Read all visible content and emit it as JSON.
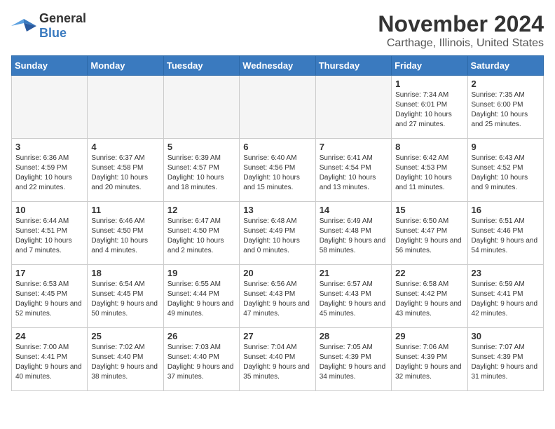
{
  "logo": {
    "general": "General",
    "blue": "Blue"
  },
  "title": "November 2024",
  "location": "Carthage, Illinois, United States",
  "days_of_week": [
    "Sunday",
    "Monday",
    "Tuesday",
    "Wednesday",
    "Thursday",
    "Friday",
    "Saturday"
  ],
  "weeks": [
    [
      {
        "day": "",
        "info": ""
      },
      {
        "day": "",
        "info": ""
      },
      {
        "day": "",
        "info": ""
      },
      {
        "day": "",
        "info": ""
      },
      {
        "day": "",
        "info": ""
      },
      {
        "day": "1",
        "info": "Sunrise: 7:34 AM\nSunset: 6:01 PM\nDaylight: 10 hours and 27 minutes."
      },
      {
        "day": "2",
        "info": "Sunrise: 7:35 AM\nSunset: 6:00 PM\nDaylight: 10 hours and 25 minutes."
      }
    ],
    [
      {
        "day": "3",
        "info": "Sunrise: 6:36 AM\nSunset: 4:59 PM\nDaylight: 10 hours and 22 minutes."
      },
      {
        "day": "4",
        "info": "Sunrise: 6:37 AM\nSunset: 4:58 PM\nDaylight: 10 hours and 20 minutes."
      },
      {
        "day": "5",
        "info": "Sunrise: 6:39 AM\nSunset: 4:57 PM\nDaylight: 10 hours and 18 minutes."
      },
      {
        "day": "6",
        "info": "Sunrise: 6:40 AM\nSunset: 4:56 PM\nDaylight: 10 hours and 15 minutes."
      },
      {
        "day": "7",
        "info": "Sunrise: 6:41 AM\nSunset: 4:54 PM\nDaylight: 10 hours and 13 minutes."
      },
      {
        "day": "8",
        "info": "Sunrise: 6:42 AM\nSunset: 4:53 PM\nDaylight: 10 hours and 11 minutes."
      },
      {
        "day": "9",
        "info": "Sunrise: 6:43 AM\nSunset: 4:52 PM\nDaylight: 10 hours and 9 minutes."
      }
    ],
    [
      {
        "day": "10",
        "info": "Sunrise: 6:44 AM\nSunset: 4:51 PM\nDaylight: 10 hours and 7 minutes."
      },
      {
        "day": "11",
        "info": "Sunrise: 6:46 AM\nSunset: 4:50 PM\nDaylight: 10 hours and 4 minutes."
      },
      {
        "day": "12",
        "info": "Sunrise: 6:47 AM\nSunset: 4:50 PM\nDaylight: 10 hours and 2 minutes."
      },
      {
        "day": "13",
        "info": "Sunrise: 6:48 AM\nSunset: 4:49 PM\nDaylight: 10 hours and 0 minutes."
      },
      {
        "day": "14",
        "info": "Sunrise: 6:49 AM\nSunset: 4:48 PM\nDaylight: 9 hours and 58 minutes."
      },
      {
        "day": "15",
        "info": "Sunrise: 6:50 AM\nSunset: 4:47 PM\nDaylight: 9 hours and 56 minutes."
      },
      {
        "day": "16",
        "info": "Sunrise: 6:51 AM\nSunset: 4:46 PM\nDaylight: 9 hours and 54 minutes."
      }
    ],
    [
      {
        "day": "17",
        "info": "Sunrise: 6:53 AM\nSunset: 4:45 PM\nDaylight: 9 hours and 52 minutes."
      },
      {
        "day": "18",
        "info": "Sunrise: 6:54 AM\nSunset: 4:45 PM\nDaylight: 9 hours and 50 minutes."
      },
      {
        "day": "19",
        "info": "Sunrise: 6:55 AM\nSunset: 4:44 PM\nDaylight: 9 hours and 49 minutes."
      },
      {
        "day": "20",
        "info": "Sunrise: 6:56 AM\nSunset: 4:43 PM\nDaylight: 9 hours and 47 minutes."
      },
      {
        "day": "21",
        "info": "Sunrise: 6:57 AM\nSunset: 4:43 PM\nDaylight: 9 hours and 45 minutes."
      },
      {
        "day": "22",
        "info": "Sunrise: 6:58 AM\nSunset: 4:42 PM\nDaylight: 9 hours and 43 minutes."
      },
      {
        "day": "23",
        "info": "Sunrise: 6:59 AM\nSunset: 4:41 PM\nDaylight: 9 hours and 42 minutes."
      }
    ],
    [
      {
        "day": "24",
        "info": "Sunrise: 7:00 AM\nSunset: 4:41 PM\nDaylight: 9 hours and 40 minutes."
      },
      {
        "day": "25",
        "info": "Sunrise: 7:02 AM\nSunset: 4:40 PM\nDaylight: 9 hours and 38 minutes."
      },
      {
        "day": "26",
        "info": "Sunrise: 7:03 AM\nSunset: 4:40 PM\nDaylight: 9 hours and 37 minutes."
      },
      {
        "day": "27",
        "info": "Sunrise: 7:04 AM\nSunset: 4:40 PM\nDaylight: 9 hours and 35 minutes."
      },
      {
        "day": "28",
        "info": "Sunrise: 7:05 AM\nSunset: 4:39 PM\nDaylight: 9 hours and 34 minutes."
      },
      {
        "day": "29",
        "info": "Sunrise: 7:06 AM\nSunset: 4:39 PM\nDaylight: 9 hours and 32 minutes."
      },
      {
        "day": "30",
        "info": "Sunrise: 7:07 AM\nSunset: 4:39 PM\nDaylight: 9 hours and 31 minutes."
      }
    ]
  ]
}
